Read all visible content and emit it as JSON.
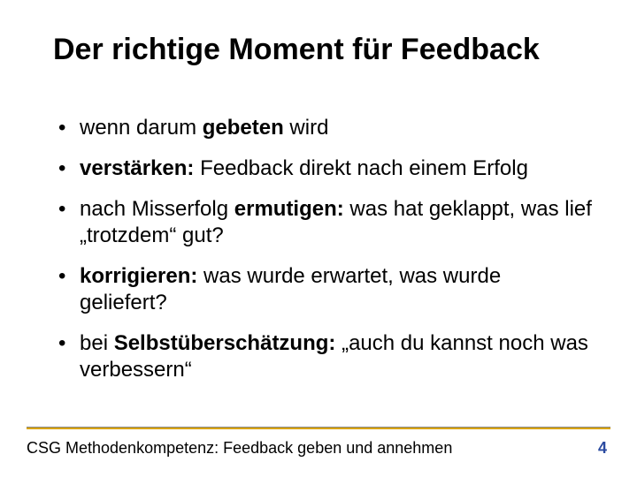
{
  "slide": {
    "title": "Der richtige Moment für Feedback",
    "bullets": [
      {
        "pre": "wenn darum ",
        "bold": "gebeten",
        "post": " wird"
      },
      {
        "pre": "",
        "bold": "verstärken:",
        "post": " Feedback direkt nach einem Erfolg"
      },
      {
        "pre": "nach Misserfolg ",
        "bold": "ermutigen:",
        "post": " was hat geklappt, was lief „trotzdem“ gut?"
      },
      {
        "pre": "",
        "bold": "korrigieren:",
        "post": " was wurde erwartet, was wurde geliefert?"
      },
      {
        "pre": "bei ",
        "bold": "Selbstüberschätzung:",
        "post": " „auch du kannst noch was verbessern“"
      }
    ],
    "footer": "CSG Methodenkompetenz: Feedback geben und annehmen",
    "page_number": "4"
  }
}
